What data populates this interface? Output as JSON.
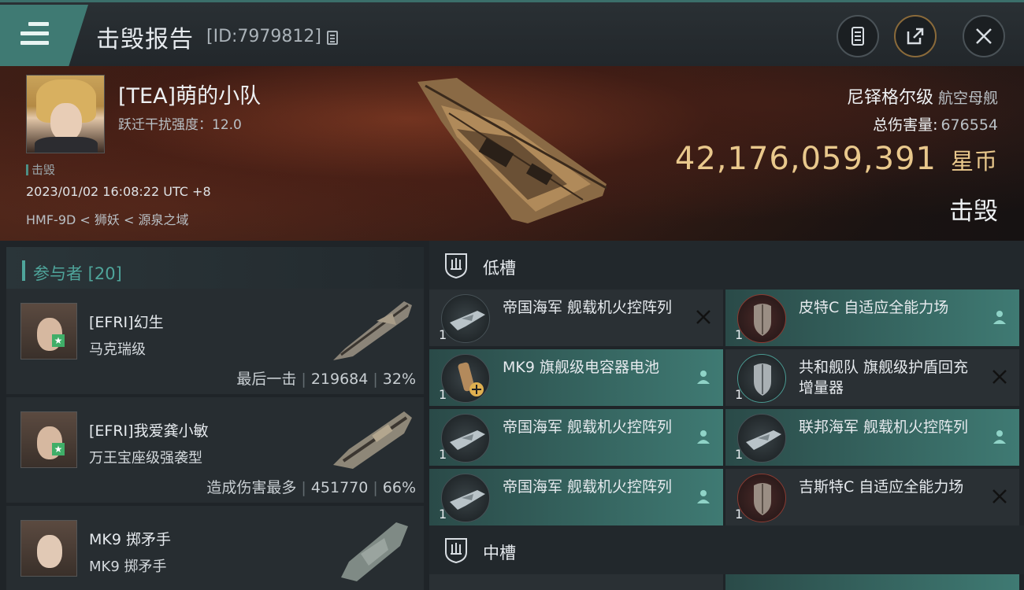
{
  "header": {
    "title": "击毁报告",
    "id_label": "[ID:7979812]"
  },
  "victim": {
    "name": "[TEA]萌的小队",
    "scram": "跃迁干扰强度：12.0",
    "tag": "击毁",
    "time": "2023/01/02 16:08:22 UTC +8",
    "location": "HMF-9D < 狮妖 < 源泉之域"
  },
  "summary": {
    "ship": "尼铎格尔级",
    "ship_type": "航空母舰",
    "damage_label": "总伤害量:",
    "damage_value": "676554",
    "isk_value": "42,176,059,391",
    "isk_unit": "星币",
    "status": "击毁"
  },
  "participants": {
    "header": "参与者 [20]",
    "rows": [
      {
        "name": "[EFRI]幻生",
        "ship": "马克瑞级",
        "label": "最后一击",
        "damage": "219684",
        "percent": "32%",
        "star": true
      },
      {
        "name": "[EFRI]我爱龚小敏",
        "ship": "万王宝座级强袭型",
        "label": "造成伤害最多",
        "damage": "451770",
        "percent": "66%",
        "star": true
      },
      {
        "name": "MK9 掷矛手",
        "ship": "MK9 掷矛手",
        "label": "",
        "damage": "",
        "percent": "",
        "star": false
      }
    ]
  },
  "slots": {
    "low": "低槽",
    "mid": "中槽",
    "modules": [
      {
        "name": "帝国海军 舰载机火控阵列",
        "qty": "1",
        "style": "dark",
        "status": "destroyed",
        "icon": "fighter"
      },
      {
        "name": "皮特C 自适应全能力场",
        "qty": "1",
        "style": "teal",
        "status": "dropped",
        "icon": "shield-red"
      },
      {
        "name": "MK9 旗舰级电容器电池",
        "qty": "1",
        "style": "teal",
        "status": "dropped",
        "icon": "battery"
      },
      {
        "name": "共和舰队 旗舰级护盾回充增量器",
        "qty": "1",
        "style": "dark",
        "status": "destroyed",
        "icon": "shield-teal"
      },
      {
        "name": "帝国海军 舰载机火控阵列",
        "qty": "1",
        "style": "teal",
        "status": "dropped",
        "icon": "fighter"
      },
      {
        "name": "联邦海军 舰载机火控阵列",
        "qty": "1",
        "style": "teal",
        "status": "dropped",
        "icon": "fighter"
      },
      {
        "name": "帝国海军 舰载机火控阵列",
        "qty": "1",
        "style": "teal",
        "status": "dropped",
        "icon": "fighter"
      },
      {
        "name": "吉斯特C 自适应全能力场",
        "qty": "1",
        "style": "dark",
        "status": "destroyed",
        "icon": "shield-red"
      }
    ]
  },
  "colors": {
    "accent": "#3f7a73",
    "accent_text": "#4fa59b",
    "isk": "#e9c88c"
  }
}
